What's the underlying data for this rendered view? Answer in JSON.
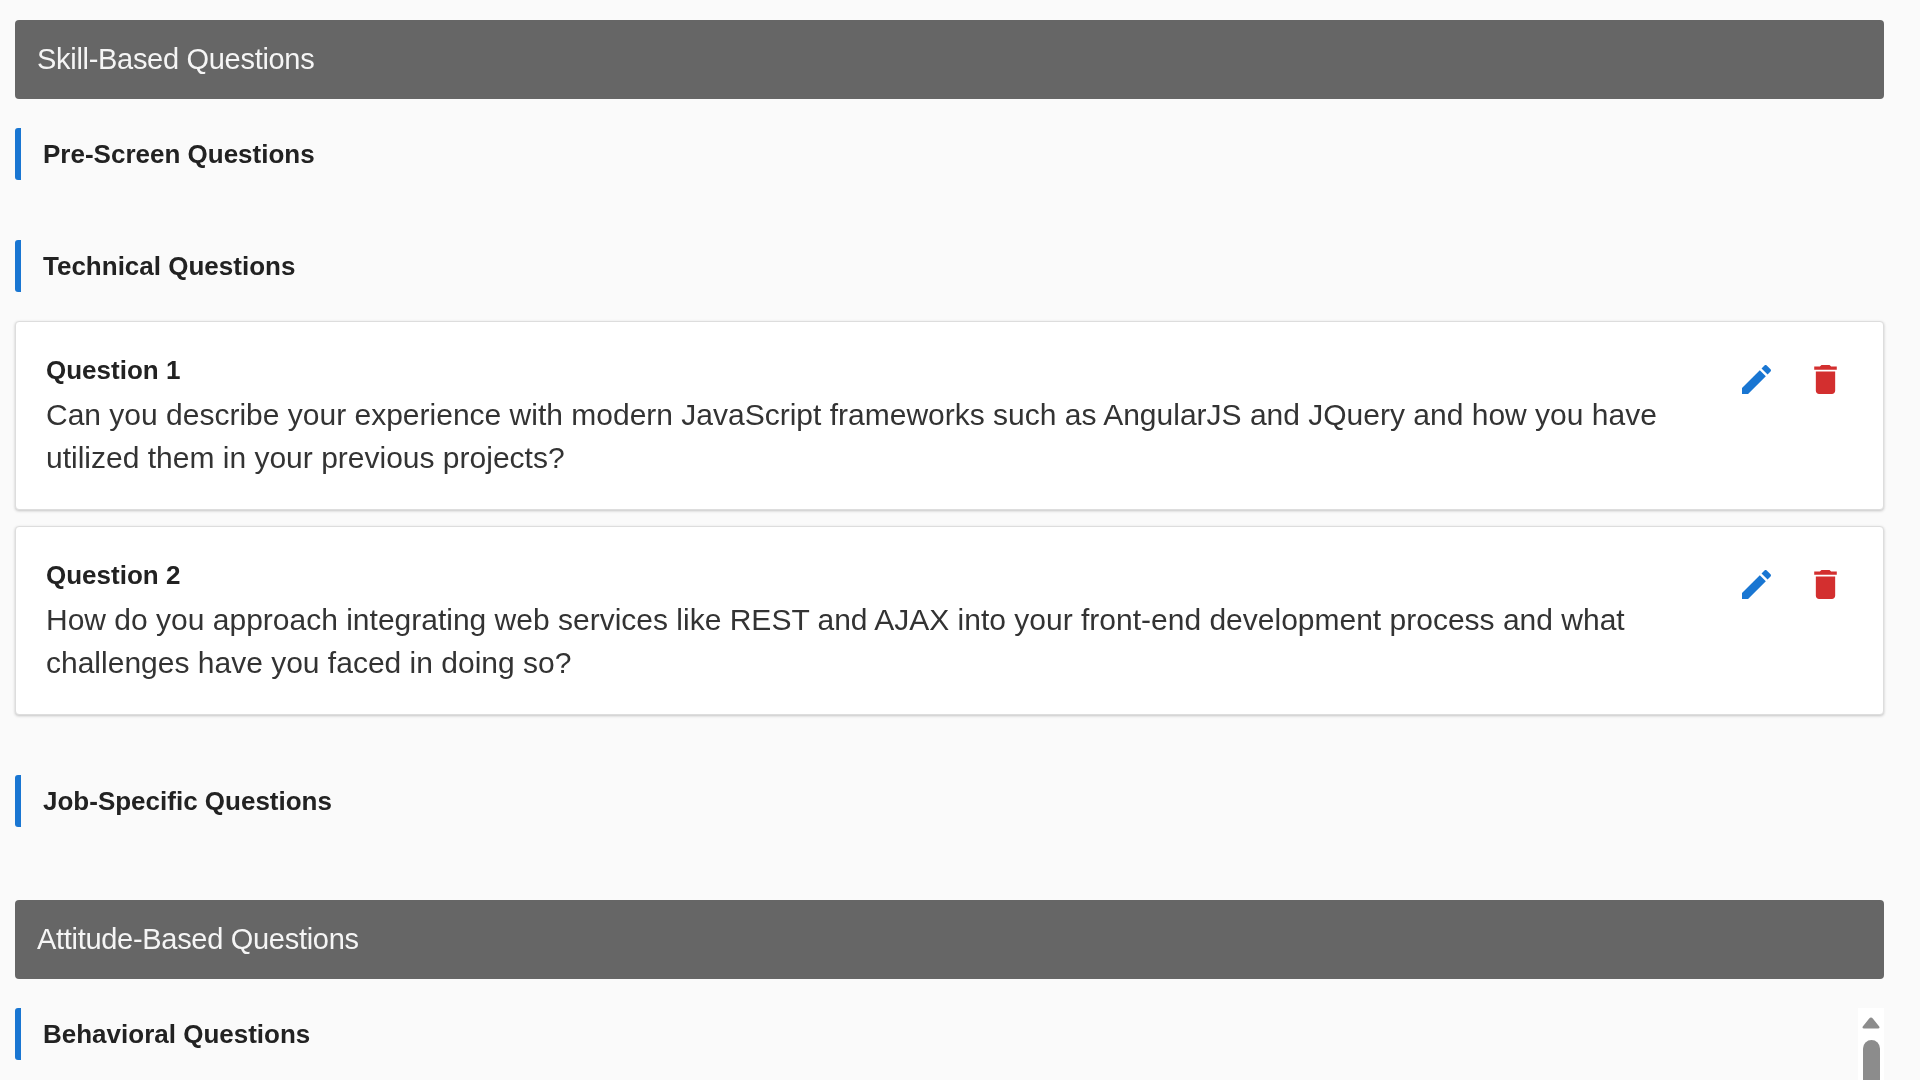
{
  "sections": [
    {
      "title": "Skill-Based Questions",
      "groups": [
        {
          "title": "Pre-Screen Questions"
        },
        {
          "title": "Technical Questions",
          "questions": [
            {
              "label": "Question 1",
              "text": "Can you describe your experience with modern JavaScript frameworks such as AngularJS and JQuery and how you have utilized them in your previous projects?"
            },
            {
              "label": "Question 2",
              "text": "How do you approach integrating web services like REST and AJAX into your front-end development process and what challenges have you faced in doing so?"
            }
          ]
        },
        {
          "title": "Job-Specific Questions"
        }
      ]
    },
    {
      "title": "Attitude-Based Questions",
      "groups": [
        {
          "title": "Behavioral Questions"
        }
      ]
    }
  ]
}
